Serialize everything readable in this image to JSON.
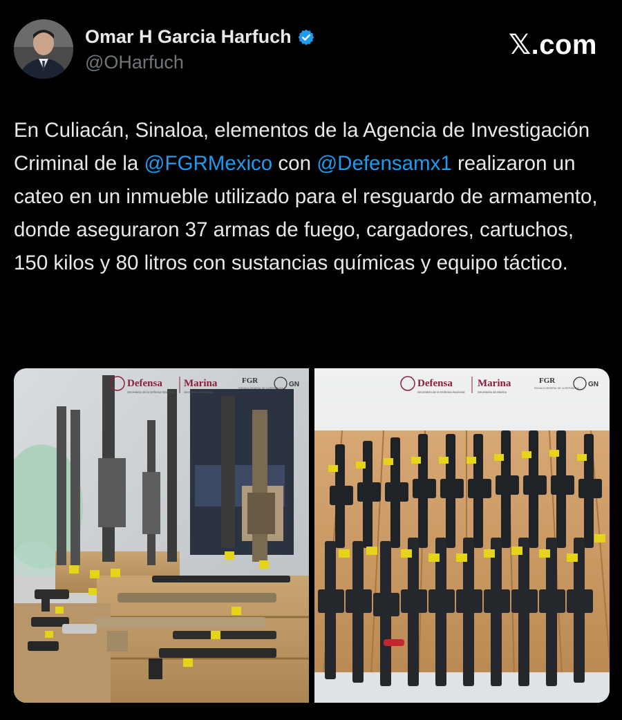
{
  "author": {
    "display_name": "Omar H Garcia Harfuch",
    "handle": "@OHarfuch",
    "verified": true,
    "verified_icon": "verified-badge-icon",
    "avatar_icon": "profile-avatar"
  },
  "brand": {
    "x_symbol": "𝕏",
    "suffix": ".com"
  },
  "tweet": {
    "text_1": "En Culiacán, Sinaloa, elementos de la Agencia de Investigación Criminal de la ",
    "mention_1": "@FGRMexico",
    "text_2": " con ",
    "mention_2": "@Defensamx1",
    "text_3": "  realizaron un cateo en un inmueble utilizado para el resguardo de armamento, donde aseguraron 37 armas de fuego, cargadores, cartuchos, 150 kilos y 80 litros con sustancias químicas y equipo táctico."
  },
  "media": {
    "photo_1": {
      "description_icon": "seized-weapons-photo",
      "watermark": {
        "defensa": "Defensa",
        "defensa_sub": "Secretaría de la Defensa Nacional",
        "marina": "Marina",
        "marina_sub": "Secretaría de Marina",
        "fgr": "FGR",
        "fgr_sub": "FISCALÍA GENERAL DE LA REPÚBLICA",
        "gn": "GN"
      }
    },
    "photo_2": {
      "description_icon": "seized-rifles-photo",
      "watermark": {
        "defensa": "Defensa",
        "defensa_sub": "Secretaría de la Defensa Nacional",
        "marina": "Marina",
        "marina_sub": "Secretaría de Marina",
        "fgr": "FGR",
        "fgr_sub": "FISCALÍA GENERAL DE LA REPÚBLICA",
        "gn": "GN"
      }
    }
  },
  "colors": {
    "background": "#000000",
    "text": "#e7e9ea",
    "secondary": "#71767b",
    "link": "#1d9bf0",
    "verified": "#1d9bf0",
    "defensa": "#8a1f3a",
    "marina": "#8a1f3a",
    "tag": "#e6d418"
  }
}
